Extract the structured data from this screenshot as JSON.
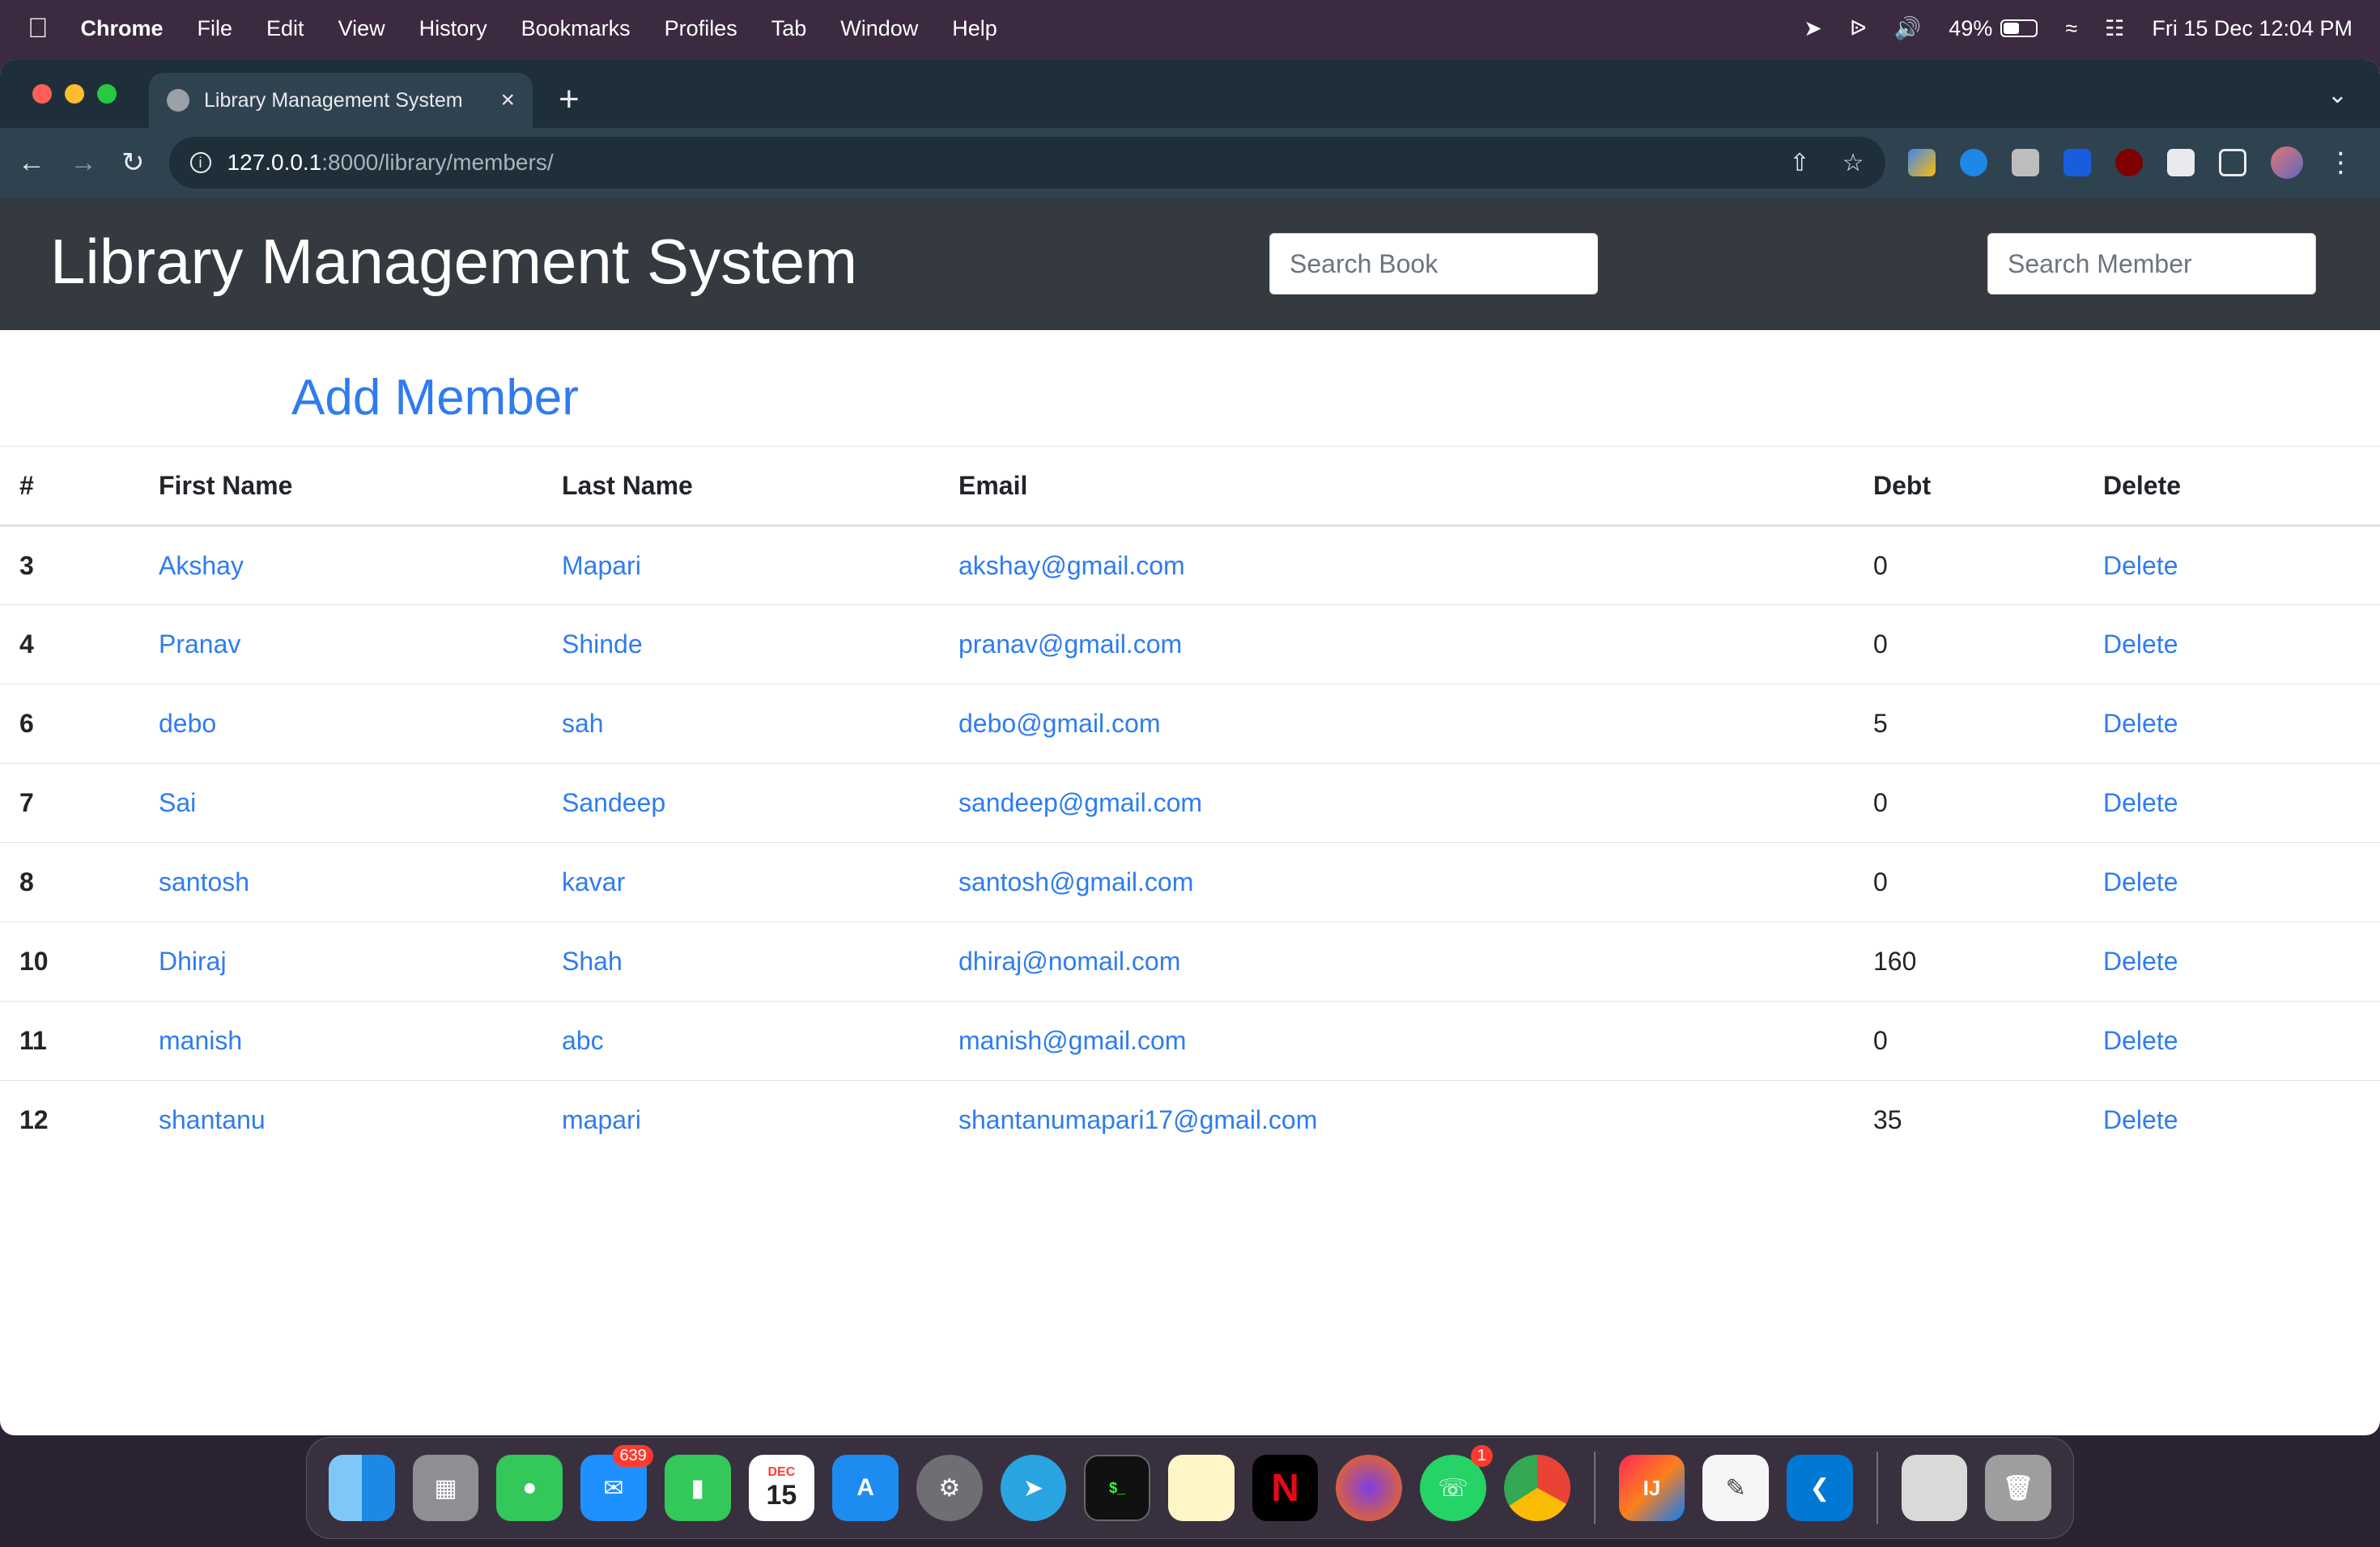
{
  "menubar": {
    "app": "Chrome",
    "items": [
      "File",
      "Edit",
      "View",
      "History",
      "Bookmarks",
      "Profiles",
      "Tab",
      "Window",
      "Help"
    ],
    "battery": "49%",
    "battery_level": 0.49,
    "datetime": "Fri 15 Dec  12:04 PM"
  },
  "browser": {
    "tab_title": "Library Management System",
    "url_host": "127.0.0.1",
    "url_path": ":8000/library/members/"
  },
  "page": {
    "brand": "Library Management System",
    "search_book_placeholder": "Search Book",
    "search_member_placeholder": "Search Member",
    "add_member": "Add Member",
    "columns": [
      "#",
      "First Name",
      "Last Name",
      "Email",
      "Debt",
      "Delete"
    ],
    "members": [
      {
        "id": "3",
        "first": "Akshay",
        "last": "Mapari",
        "email": "akshay@gmail.com",
        "debt": "0",
        "delete": "Delete"
      },
      {
        "id": "4",
        "first": "Pranav",
        "last": "Shinde",
        "email": "pranav@gmail.com",
        "debt": "0",
        "delete": "Delete"
      },
      {
        "id": "6",
        "first": "debo",
        "last": "sah",
        "email": "debo@gmail.com",
        "debt": "5",
        "delete": "Delete"
      },
      {
        "id": "7",
        "first": "Sai",
        "last": "Sandeep",
        "email": "sandeep@gmail.com",
        "debt": "0",
        "delete": "Delete"
      },
      {
        "id": "8",
        "first": "santosh",
        "last": "kavar",
        "email": "santosh@gmail.com",
        "debt": "0",
        "delete": "Delete"
      },
      {
        "id": "10",
        "first": "Dhiraj",
        "last": "Shah",
        "email": "dhiraj@nomail.com",
        "debt": "160",
        "delete": "Delete"
      },
      {
        "id": "11",
        "first": "manish",
        "last": "abc",
        "email": "manish@gmail.com",
        "debt": "0",
        "delete": "Delete"
      },
      {
        "id": "12",
        "first": "shantanu",
        "last": "mapari",
        "email": "shantanumapari17@gmail.com",
        "debt": "35",
        "delete": "Delete"
      }
    ]
  },
  "dock": {
    "calendar_month": "DEC",
    "calendar_day": "15",
    "mail_badge": "639",
    "whatsapp_badge": "1",
    "apps": [
      "finder-icon",
      "launchpad-icon",
      "messages-icon",
      "mail-icon",
      "facetime-icon",
      "calendar-icon",
      "app-store-icon",
      "system-settings-icon",
      "telegram-icon",
      "terminal-icon",
      "notes-icon",
      "netflix-icon",
      "firefox-icon",
      "whatsapp-icon",
      "chrome-icon",
      "intellij-icon",
      "textedit-icon",
      "vscode-icon",
      "preview-icon",
      "trash-icon"
    ]
  },
  "colors": {
    "link": "#2f7cf0",
    "header_bg": "#343a40",
    "browser_toolbar": "#2f4250"
  }
}
